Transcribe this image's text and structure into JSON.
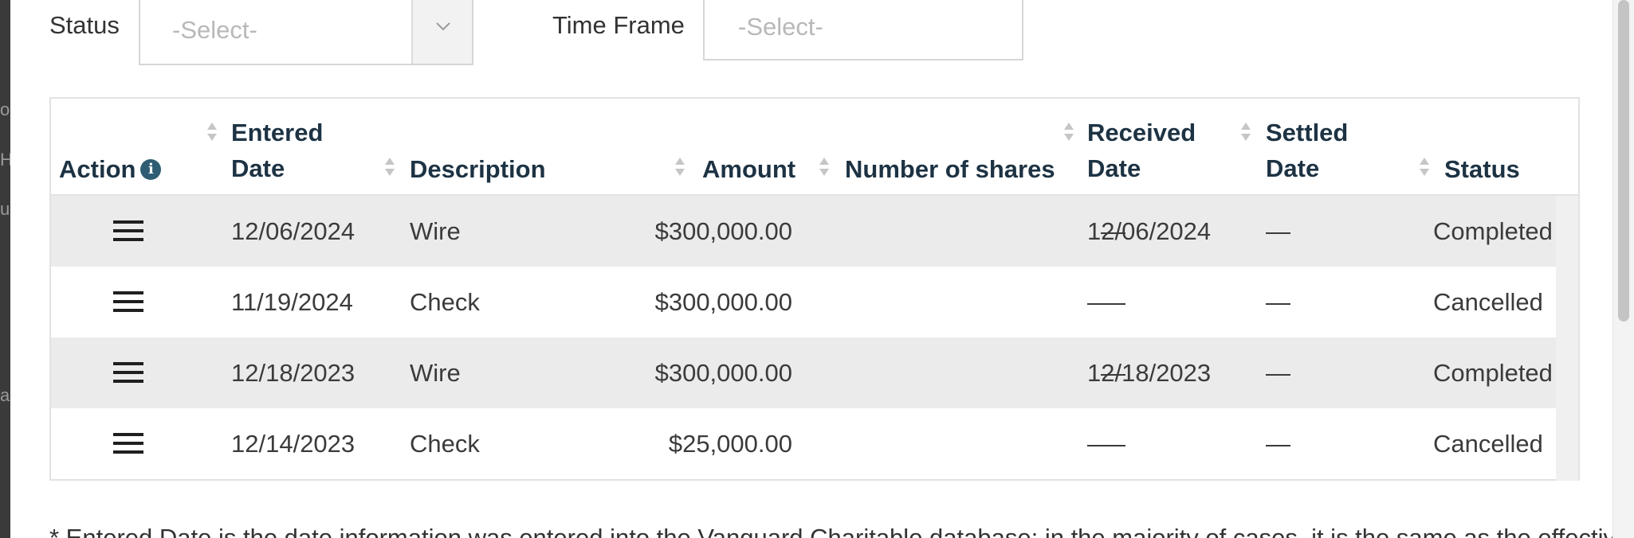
{
  "filters": {
    "status_label": "Status",
    "status_placeholder": "-Select-",
    "timeframe_label": "Time Frame",
    "timeframe_placeholder": "-Select-"
  },
  "table": {
    "headers": {
      "action": "Action",
      "entered_date_l1": "Entered",
      "entered_date_l2": "Date",
      "description": "Description",
      "amount": "Amount",
      "shares": "Number of shares",
      "received_date_l1": "Received",
      "received_date_l2": "Date",
      "settled_date_l1": "Settled",
      "settled_date_l2": "Date",
      "status": "Status"
    },
    "info_icon_glyph": "i",
    "rows": [
      {
        "entered": "12/06/2024",
        "description": "Wire",
        "amount": "$300,000.00",
        "shares": "—",
        "received": "12/06/2024",
        "settled": "—",
        "status": "Completed"
      },
      {
        "entered": "11/19/2024",
        "description": "Check",
        "amount": "$300,000.00",
        "shares": "—",
        "received": "—",
        "settled": "—",
        "status": "Cancelled"
      },
      {
        "entered": "12/18/2023",
        "description": "Wire",
        "amount": "$300,000.00",
        "shares": "—",
        "received": "12/18/2023",
        "settled": "—",
        "status": "Completed"
      },
      {
        "entered": "12/14/2023",
        "description": "Check",
        "amount": "$25,000.00",
        "shares": "—",
        "received": "—",
        "settled": "—",
        "status": "Cancelled"
      }
    ]
  },
  "footnote": "* Entered Date is the date information was entered into the Vanguard Charitable database; in the majority of cases, it is the same as the effective date.",
  "icons": {
    "row_action": "menu-icon",
    "sort": "sort-icon",
    "info": "info-icon",
    "dropdown": "chevron-down-icon"
  },
  "colors": {
    "header_text": "#1d3344",
    "info_icon": "#2e5d73",
    "row_shade": "#ebebeb",
    "placeholder": "#b8b8b8"
  }
}
